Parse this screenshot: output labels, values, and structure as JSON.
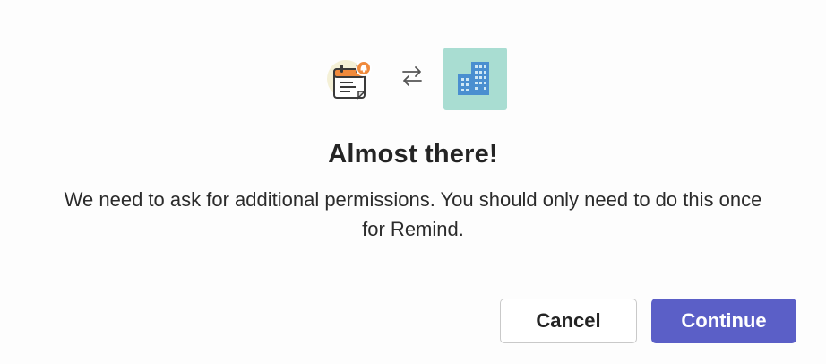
{
  "dialog": {
    "title": "Almost there!",
    "message": "We need to ask for additional permissions. You should only need to do this once for Remind.",
    "buttons": {
      "cancel_label": "Cancel",
      "continue_label": "Continue"
    }
  },
  "icons": {
    "app": "calendar-reminder-icon",
    "swap": "swap-arrows-icon",
    "org": "building-icon"
  },
  "colors": {
    "accent": "#5b5fc7",
    "org_tile_bg": "#a9ddd2",
    "building_blue": "#4a8fd0",
    "calendar_orange": "#f08a3c"
  }
}
